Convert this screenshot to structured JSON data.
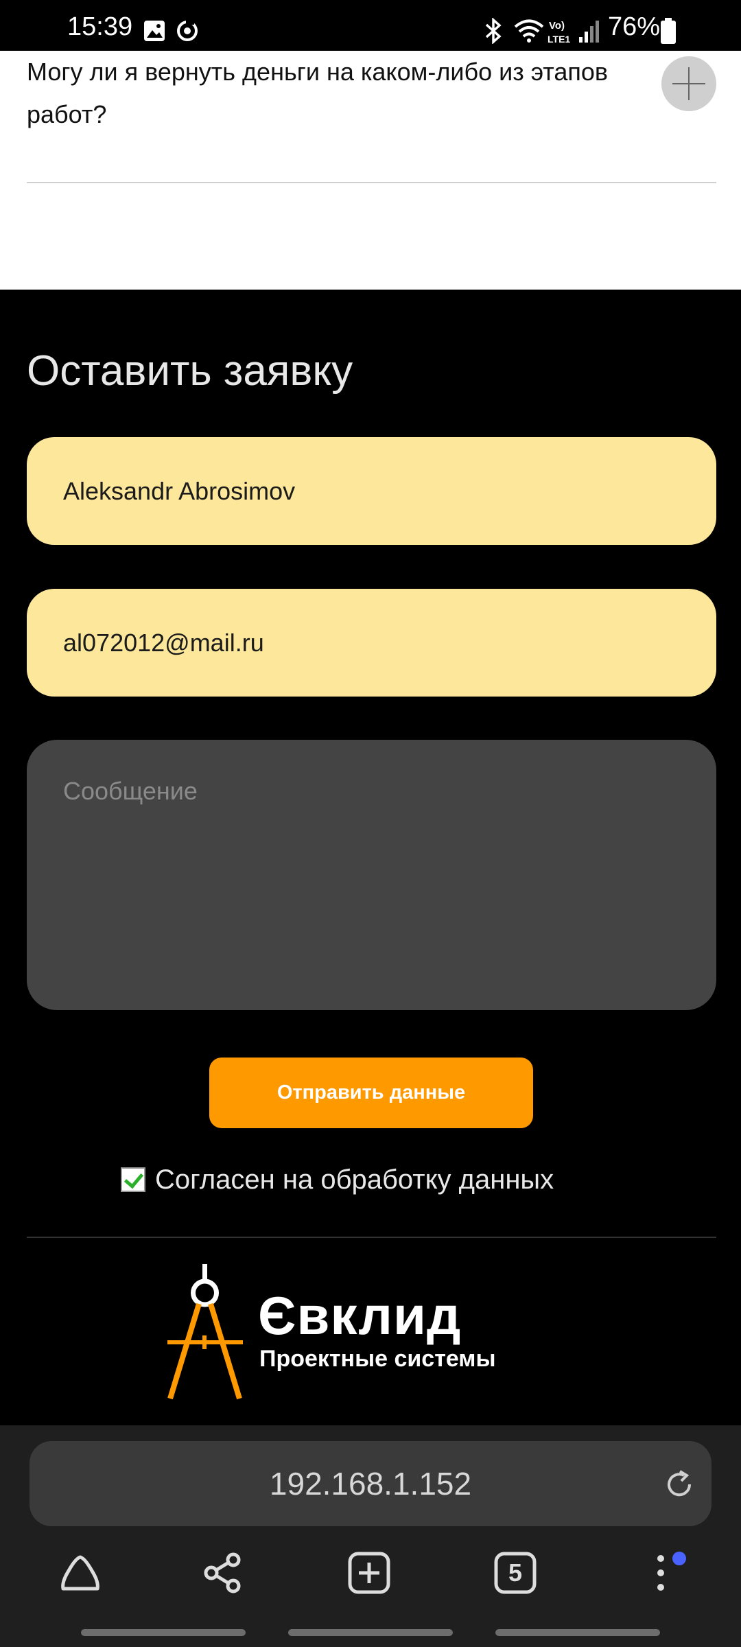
{
  "status_bar": {
    "time": "15:39",
    "battery": "76%",
    "icons": [
      "gallery-icon",
      "sync-icon",
      "bluetooth-icon",
      "wifi-icon",
      "volte-icon",
      "signal-icon",
      "battery-icon"
    ]
  },
  "faq": {
    "question": "Могу ли я вернуть деньги на каком-либо из этапов работ?",
    "expand_icon": "plus-icon"
  },
  "form": {
    "title": "Оставить заявку",
    "name_value": "Aleksandr Abrosimov",
    "email_value": "al072012@mail.ru",
    "message_placeholder": "Сообщение",
    "submit_label": "Отправить данные",
    "consent_label": "Согласен на обработку данных",
    "consent_checked": true
  },
  "logo": {
    "name": "Євклид",
    "tagline": "Проектные системы",
    "mark_icon": "compass-icon"
  },
  "browser": {
    "url": "192.168.1.152",
    "tab_count": "5",
    "nav": [
      "home-icon",
      "share-icon",
      "new-tab-icon",
      "tabs-icon",
      "menu-icon"
    ]
  },
  "colors": {
    "accent": "#ff9900",
    "field_bg": "#fce79b",
    "message_bg": "#444444",
    "background": "#000000"
  }
}
